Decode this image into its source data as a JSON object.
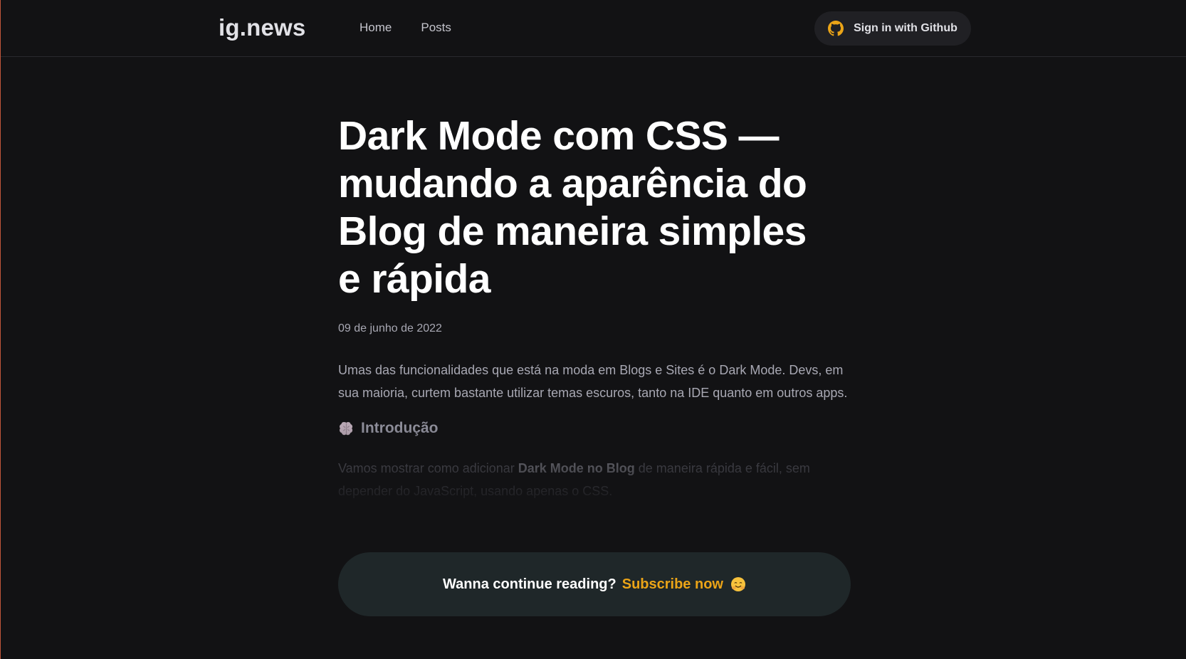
{
  "header": {
    "logo": "ig.news",
    "nav": [
      {
        "label": "Home"
      },
      {
        "label": "Posts"
      }
    ],
    "signin_label": "Sign in with Github",
    "signin_icon": "github-icon",
    "signin_icon_color": "#eba417"
  },
  "post": {
    "title": "Dark Mode com CSS — mudando a aparência do Blog de maneira simples e rápida",
    "date": "09 de junho de 2022",
    "intro": "Umas das funcionalidades que está na moda em Blogs e Sites é o Dark Mode. Devs, em sua maioria, curtem bastante utilizar temas escuros, tanto na IDE quanto em outros apps.",
    "section_heading": "Introdução",
    "section_heading_icon": "brain-icon",
    "preview": {
      "before": "Vamos mostrar como adicionar ",
      "bold": "Dark Mode no Blog",
      "after": " de maneira rápida e fácil, sem depender do JavaScript, usando apenas o CSS."
    }
  },
  "continue_reading": {
    "text": "Wanna continue reading?",
    "link_label": "Subscribe now",
    "emoji_icon": "hugging-face-icon",
    "accent_color": "#eba417"
  }
}
